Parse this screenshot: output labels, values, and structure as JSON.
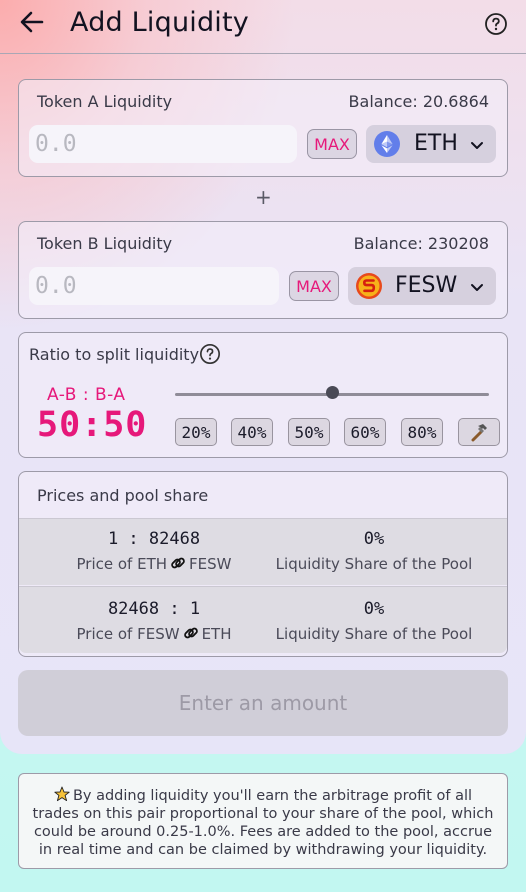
{
  "header": {
    "title": "Add Liquidity"
  },
  "tokenA": {
    "label": "Token A Liquidity",
    "balance": "Balance: 20.6864",
    "placeholder": "0.0",
    "max_label": "MAX",
    "token": "ETH",
    "icon": "ethereum-icon"
  },
  "plus": "+",
  "tokenB": {
    "label": "Token B Liquidity",
    "balance": "Balance: 230208",
    "placeholder": "0.0",
    "max_label": "MAX",
    "token": "FESW",
    "icon": "feswap-icon"
  },
  "ratio": {
    "label": "Ratio to split liquidity",
    "ab_label": "A-B : B-A",
    "value": "50:50",
    "slider_fraction": 0.5,
    "presets": [
      "20%",
      "40%",
      "50%",
      "60%",
      "80%"
    ],
    "tool_icon": "hammer-icon"
  },
  "prices": {
    "title": "Prices and pool share",
    "rows": [
      {
        "price": "1 : 82468",
        "price_label_a": "Price of ETH",
        "price_label_b": "FESW",
        "share": "0%",
        "share_label": "Liquidity Share of the Pool"
      },
      {
        "price": "82468 : 1",
        "price_label_a": "Price of FESW",
        "price_label_b": "ETH",
        "share": "0%",
        "share_label": "Liquidity Share of the Pool"
      }
    ]
  },
  "submit_label": "Enter an amount",
  "info": {
    "line1": "By adding liquidity you'll earn the arbitrage profit of all",
    "line2": "trades on this pair proportional to your share of the pool, which",
    "line3": "could be around 0.25-1.0%. Fees are added to the pool, accrue",
    "line4": "in real time and can be claimed by withdrawing your liquidity."
  },
  "colors": {
    "accent": "#e6187a",
    "eth": "#627eea",
    "fesw": "#e8491b"
  }
}
